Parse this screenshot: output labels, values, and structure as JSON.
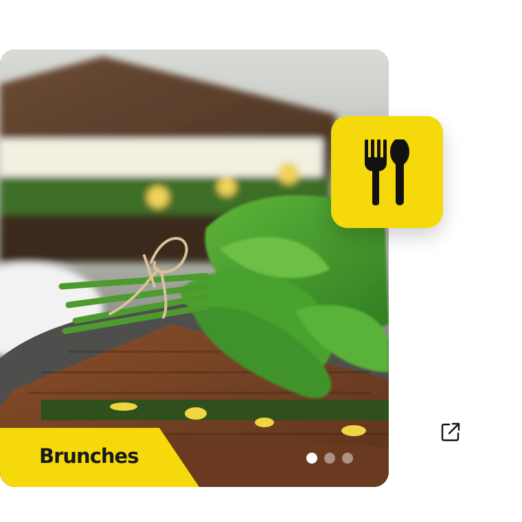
{
  "card": {
    "caption": "Brunches",
    "slides_total": 3,
    "active_slide": 1
  },
  "badge": {
    "icon": "fork-spoon-icon",
    "background": "#f5d90a"
  },
  "external_link": {
    "icon": "external-link-icon"
  },
  "colors": {
    "accent": "#f5d90a",
    "text_dark": "#1a1a1a"
  }
}
